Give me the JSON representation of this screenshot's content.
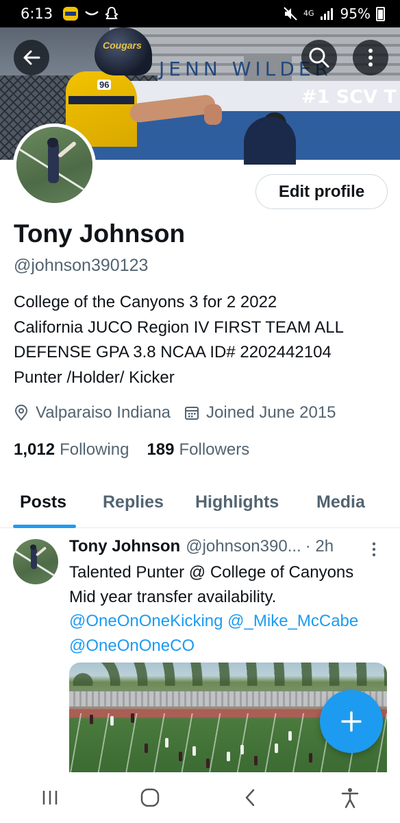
{
  "status_bar": {
    "time": "6:13",
    "battery": "95%",
    "network": "4G"
  },
  "banner": {
    "helmet_text": "Cougars",
    "jersey_number": "96",
    "sign_top": "JENN WILDER",
    "sign_bottom": "#1 SCV T"
  },
  "profile": {
    "edit_button": "Edit profile",
    "name": "Tony Johnson",
    "handle": "@johnson390123",
    "bio": "College of the Canyons 3 for 2 2022\nCalifornia JUCO  Region IV FIRST TEAM ALL\nDEFENSE  GPA 3.8 NCAA ID# 2202442104\nPunter /Holder/ Kicker",
    "location": "Valparaiso Indiana",
    "joined": "Joined June 2015",
    "following_count": "1,012",
    "following_label": "Following",
    "followers_count": "189",
    "followers_label": "Followers"
  },
  "tabs": [
    "Posts",
    "Replies",
    "Highlights",
    "Media"
  ],
  "tweet": {
    "name": "Tony Johnson",
    "handle": "@johnson390...",
    "time": "· 2h",
    "line1": "Talented Punter @ College of Canyons",
    "line2": "Mid year transfer availability.",
    "mention1": "@OneOnOneKicking",
    "mention2": "@_Mike_McCabe",
    "mention3": "@OneOnOneCO"
  },
  "colors": {
    "accent": "#1d9bf0",
    "text_primary": "#0f1419",
    "text_secondary": "#536471"
  },
  "icons": {
    "back": "arrow-left-icon",
    "search": "search-icon",
    "more": "more-vertical-icon",
    "location": "location-pin-icon",
    "calendar": "calendar-icon",
    "compose": "plus-icon"
  }
}
